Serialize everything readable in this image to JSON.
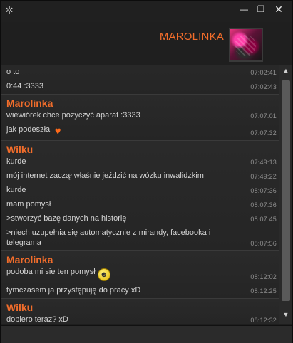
{
  "window": {
    "app_icon": "gear-icon",
    "buttons": {
      "minimize": "—",
      "maximize": "❐",
      "close": "✕"
    }
  },
  "contact": {
    "name": "MAROLINKA",
    "avatar_icon": "avatar-picture"
  },
  "colors": {
    "accent": "#f26d2b",
    "background": "#232323",
    "text": "#d4d4d4",
    "timestamp": "#8f8f8f"
  },
  "messages": [
    {
      "sender": "Wilku",
      "items": [
        {
          "text": "o to",
          "time": "07:02:41"
        },
        {
          "text": "0:44 :3333",
          "time": "07:02:43"
        }
      ]
    },
    {
      "sender": "Marolinka",
      "items": [
        {
          "text": "wiewiórek chce pozyczyć aparat :3333",
          "time": "07:07:01"
        },
        {
          "text": "jak podeszła",
          "time": "07:07:32",
          "emoji": "heart-icon"
        }
      ]
    },
    {
      "sender": "Wilku",
      "items": [
        {
          "text": "kurde",
          "time": "07:49:13"
        },
        {
          "text": "mój internet zaczął właśnie jeździć na wózku inwalidzkim",
          "time": "07:49:22"
        },
        {
          "text": "kurde",
          "time": "08:07:36"
        },
        {
          "text": "mam pomysł",
          "time": "08:07:36"
        },
        {
          "text": ">stworzyć bazę danych na historię",
          "time": "08:07:45"
        },
        {
          "text": ">niech uzupełnia się automatycznie z mirandy, facebooka i telegrama",
          "time": "08:07:56"
        }
      ]
    },
    {
      "sender": "Marolinka",
      "items": [
        {
          "text": "podoba mi sie ten pomysł",
          "time": "08:12:02",
          "emoji": "grin-icon"
        },
        {
          "text": "tymczasem ja przystępuję do pracy xD",
          "time": "08:12:25"
        }
      ]
    },
    {
      "sender": "Wilku",
      "items": [
        {
          "text": "dopiero teraz? xD",
          "time": "08:12:32"
        }
      ]
    }
  ],
  "input": {
    "value": "",
    "placeholder": ""
  }
}
